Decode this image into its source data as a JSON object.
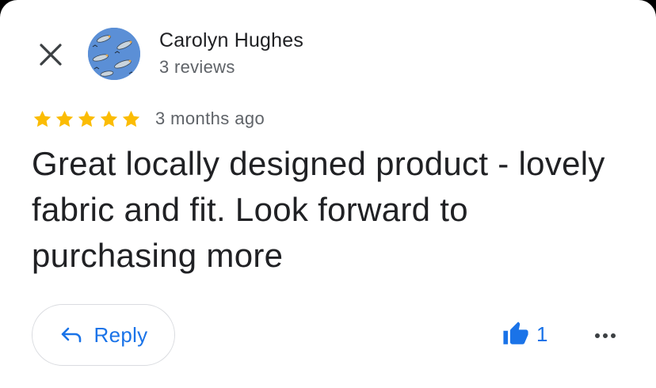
{
  "review": {
    "author_name": "Carolyn Hughes",
    "author_meta": "3 reviews",
    "rating": 5,
    "date": "3 months ago",
    "text": "Great locally designed product - lovely fabric and fit. Look forward to purchasing more"
  },
  "actions": {
    "reply_label": "Reply",
    "like_count": "1"
  },
  "colors": {
    "accent": "#1a73e8",
    "star": "#fbbc04",
    "text_primary": "#202124",
    "text_secondary": "#5f6368"
  },
  "icons": {
    "close": "close-icon",
    "reply": "reply-arrow-icon",
    "like": "thumbs-up-icon",
    "more": "more-horizontal-icon",
    "star": "star-icon"
  }
}
